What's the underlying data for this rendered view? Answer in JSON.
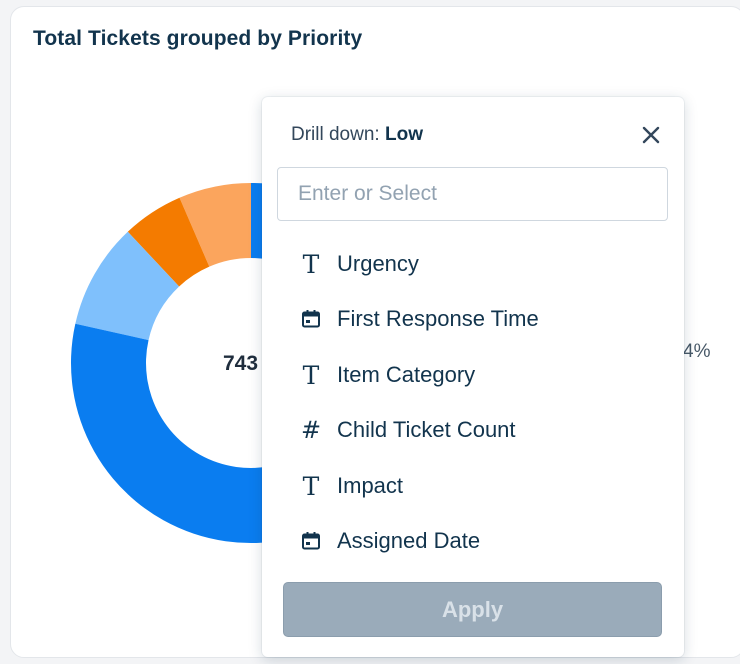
{
  "card": {
    "title": "Total Tickets grouped by Priority",
    "center_value": "743",
    "side_label": "4%"
  },
  "chart_data": {
    "type": "pie",
    "variant": "donut",
    "title": "Total Tickets grouped by Priority",
    "total": "743",
    "slices": [
      {
        "name": "",
        "color": "#0a7df0",
        "fraction": 0.7
      },
      {
        "name": "",
        "color": "#7fc0fc",
        "fraction": 0.095
      },
      {
        "name": "",
        "color": "#f47b00",
        "fraction": 0.055
      },
      {
        "name": "",
        "color": "#fba55d",
        "fraction": 0.065
      }
    ]
  },
  "popover": {
    "header_prefix": "Drill down:",
    "header_value": "Low",
    "search_placeholder": "Enter or Select",
    "options": [
      {
        "label": "Urgency",
        "icon": "text-type-icon"
      },
      {
        "label": "First Response Time",
        "icon": "calendar-icon"
      },
      {
        "label": "Item Category",
        "icon": "text-type-icon"
      },
      {
        "label": "Child Ticket Count",
        "icon": "number-hash-icon"
      },
      {
        "label": "Impact",
        "icon": "text-type-icon"
      },
      {
        "label": "Assigned Date",
        "icon": "calendar-icon"
      }
    ],
    "apply_label": "Apply"
  }
}
